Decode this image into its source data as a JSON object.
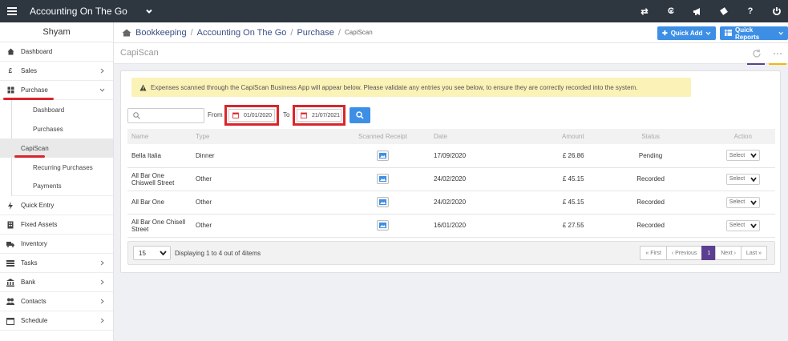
{
  "topbar": {
    "app_title": "Accounting On The Go",
    "icons": [
      "swap-icon",
      "currency-icon",
      "megaphone-icon",
      "tag-icon",
      "help-icon",
      "power-icon"
    ],
    "icon_glyphs": [
      "⇄",
      "₢",
      "",
      "",
      "?",
      "⏻"
    ]
  },
  "sidebar": {
    "user": "Shyam",
    "items": {
      "dashboard": "Dashboard",
      "sales": "Sales",
      "purchase": "Purchase",
      "quick_entry": "Quick Entry",
      "fixed_assets": "Fixed Assets",
      "inventory": "Inventory",
      "tasks": "Tasks",
      "bank": "Bank",
      "contacts": "Contacts",
      "schedule": "Schedule"
    },
    "sales_glyph": "£",
    "sub": {
      "dashboard": "Dashboard",
      "purchases": "Purchases",
      "capiscan": "CapiScan",
      "recurring": "Recurring Purchases",
      "payments": "Payments"
    }
  },
  "breadcrumb": {
    "bookkeeping": "Bookkeeping",
    "company": "Accounting On The Go",
    "purchase": "Purchase",
    "current": "CapiScan",
    "sep": "/"
  },
  "buttons": {
    "quick_add": "Quick Add",
    "quick_reports": "Quick Reports"
  },
  "page": {
    "title": "CapiScan"
  },
  "alert": {
    "text": "Expenses scanned through the CapiScan Business App will appear below. Please validate any entries you see below, to ensure they are correctly recorded into the system."
  },
  "filters": {
    "search_placeholder": "",
    "from_label": "From",
    "from_value": "01/01/2020",
    "to_label": "To",
    "to_value": "21/07/2021"
  },
  "table": {
    "headers": {
      "name": "Name",
      "type": "Type",
      "receipt": "Scanned Receipt",
      "date": "Date",
      "amount": "Amount",
      "status": "Status",
      "action": "Action"
    },
    "rows": [
      {
        "name": "Bella Italia",
        "type": "Dinner",
        "date": "17/09/2020",
        "amount": "£ 26.86",
        "status": "Pending",
        "action": "Select"
      },
      {
        "name": "All Bar One Chiswell Street",
        "type": "Other",
        "date": "24/02/2020",
        "amount": "£ 45.15",
        "status": "Recorded",
        "action": "Select"
      },
      {
        "name": "All Bar One",
        "type": "Other",
        "date": "24/02/2020",
        "amount": "£ 45.15",
        "status": "Recorded",
        "action": "Select"
      },
      {
        "name": "All Bar One Chisell Street",
        "type": "Other",
        "date": "16/01/2020",
        "amount": "£ 27.55",
        "status": "Recorded",
        "action": "Select"
      }
    ]
  },
  "footer": {
    "page_size": "15",
    "display_text": "Displaying 1 to 4 out of 4items",
    "first": "« First",
    "previous": "‹ Previous",
    "current_page": "1",
    "next": "Next ›",
    "last": "Last »"
  },
  "colors": {
    "topbar": "#2e3640",
    "accent_blue": "#3d8fe6",
    "pager_active": "#5b3f90",
    "highlight_red": "#d9262c",
    "recorded_green": "#3fb26a",
    "alert_yellow": "#fbf2b7"
  }
}
